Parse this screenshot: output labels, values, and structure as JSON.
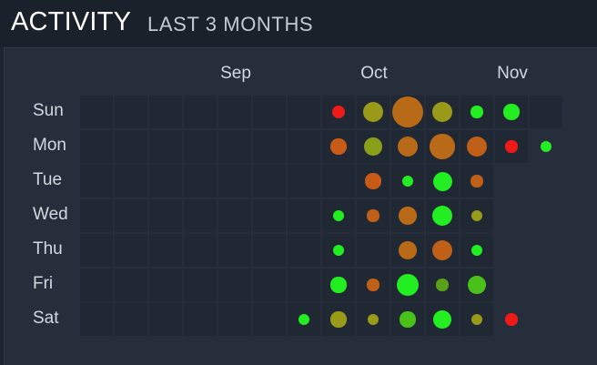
{
  "header": {
    "title": "ACTIVITY",
    "subtitle": "LAST 3 MONTHS"
  },
  "months": [
    {
      "label": "Sep",
      "col": 4.5
    },
    {
      "label": "Oct",
      "col": 8.5
    },
    {
      "label": "Nov",
      "col": 12.5
    }
  ],
  "days": [
    "Sun",
    "Mon",
    "Tue",
    "Wed",
    "Thu",
    "Fri",
    "Sat"
  ],
  "colors": {
    "low": "#22ee22",
    "mid": "#9a9a1a",
    "high": "#b96a18",
    "peak": "#ee1a1a",
    "cell": "#202833"
  },
  "grid": {
    "columns": 14,
    "cells": [
      [
        1,
        1,
        1,
        1,
        1,
        1,
        1,
        1,
        1,
        1,
        1,
        1,
        1,
        1
      ],
      [
        1,
        1,
        1,
        1,
        1,
        1,
        1,
        1,
        1,
        1,
        1,
        1,
        1,
        0
      ],
      [
        1,
        1,
        1,
        1,
        1,
        1,
        1,
        1,
        1,
        1,
        1,
        1,
        0,
        0
      ],
      [
        1,
        1,
        1,
        1,
        1,
        1,
        1,
        1,
        1,
        1,
        1,
        1,
        0,
        0
      ],
      [
        1,
        1,
        1,
        1,
        1,
        1,
        1,
        1,
        1,
        1,
        1,
        1,
        0,
        0
      ],
      [
        1,
        1,
        1,
        1,
        1,
        1,
        1,
        1,
        1,
        1,
        1,
        1,
        0,
        0
      ],
      [
        1,
        1,
        1,
        1,
        1,
        1,
        1,
        1,
        1,
        1,
        1,
        1,
        0,
        0
      ]
    ]
  },
  "activity": [
    {
      "day": 0,
      "col": 7,
      "level": 0.25,
      "color": "#ee1a1a"
    },
    {
      "day": 0,
      "col": 8,
      "level": 0.55,
      "color": "#9a9a1a"
    },
    {
      "day": 0,
      "col": 9,
      "level": 1.0,
      "color": "#b96a18"
    },
    {
      "day": 0,
      "col": 10,
      "level": 0.55,
      "color": "#9a9a1a"
    },
    {
      "day": 0,
      "col": 11,
      "level": 0.2,
      "color": "#22ee22"
    },
    {
      "day": 0,
      "col": 12,
      "level": 0.35,
      "color": "#22ee22"
    },
    {
      "day": 1,
      "col": 7,
      "level": 0.35,
      "color": "#c85a18"
    },
    {
      "day": 1,
      "col": 8,
      "level": 0.45,
      "color": "#8aa01a"
    },
    {
      "day": 1,
      "col": 9,
      "level": 0.55,
      "color": "#b96a18"
    },
    {
      "day": 1,
      "col": 10,
      "level": 0.75,
      "color": "#b96a18"
    },
    {
      "day": 1,
      "col": 11,
      "level": 0.55,
      "color": "#c06018"
    },
    {
      "day": 1,
      "col": 12,
      "level": 0.2,
      "color": "#ee1a1a"
    },
    {
      "day": 1,
      "col": 13,
      "level": 0.18,
      "color": "#22ee22"
    },
    {
      "day": 2,
      "col": 8,
      "level": 0.35,
      "color": "#c85a18"
    },
    {
      "day": 2,
      "col": 9,
      "level": 0.18,
      "color": "#22ee22"
    },
    {
      "day": 2,
      "col": 10,
      "level": 0.5,
      "color": "#22ee22"
    },
    {
      "day": 2,
      "col": 11,
      "level": 0.2,
      "color": "#c06018"
    },
    {
      "day": 3,
      "col": 7,
      "level": 0.18,
      "color": "#22ee22"
    },
    {
      "day": 3,
      "col": 8,
      "level": 0.2,
      "color": "#c06018"
    },
    {
      "day": 3,
      "col": 9,
      "level": 0.45,
      "color": "#b96a18"
    },
    {
      "day": 3,
      "col": 10,
      "level": 0.55,
      "color": "#22ee22"
    },
    {
      "day": 3,
      "col": 11,
      "level": 0.16,
      "color": "#9a9a1a"
    },
    {
      "day": 4,
      "col": 7,
      "level": 0.18,
      "color": "#22ee22"
    },
    {
      "day": 4,
      "col": 9,
      "level": 0.45,
      "color": "#b96a18"
    },
    {
      "day": 4,
      "col": 10,
      "level": 0.55,
      "color": "#c06018"
    },
    {
      "day": 4,
      "col": 11,
      "level": 0.18,
      "color": "#22ee22"
    },
    {
      "day": 5,
      "col": 7,
      "level": 0.35,
      "color": "#22ee22"
    },
    {
      "day": 5,
      "col": 8,
      "level": 0.2,
      "color": "#c06018"
    },
    {
      "day": 5,
      "col": 9,
      "level": 0.65,
      "color": "#22ee22"
    },
    {
      "day": 5,
      "col": 10,
      "level": 0.2,
      "color": "#5aa01a"
    },
    {
      "day": 5,
      "col": 11,
      "level": 0.45,
      "color": "#4ac01a"
    },
    {
      "day": 6,
      "col": 6,
      "level": 0.18,
      "color": "#22ee22"
    },
    {
      "day": 6,
      "col": 7,
      "level": 0.35,
      "color": "#9a9a1a"
    },
    {
      "day": 6,
      "col": 8,
      "level": 0.18,
      "color": "#9a9a1a"
    },
    {
      "day": 6,
      "col": 9,
      "level": 0.35,
      "color": "#4ac01a"
    },
    {
      "day": 6,
      "col": 10,
      "level": 0.45,
      "color": "#22ee22"
    },
    {
      "day": 6,
      "col": 11,
      "level": 0.16,
      "color": "#9a9a1a"
    },
    {
      "day": 6,
      "col": 12,
      "level": 0.2,
      "color": "#ee1a1a"
    }
  ]
}
